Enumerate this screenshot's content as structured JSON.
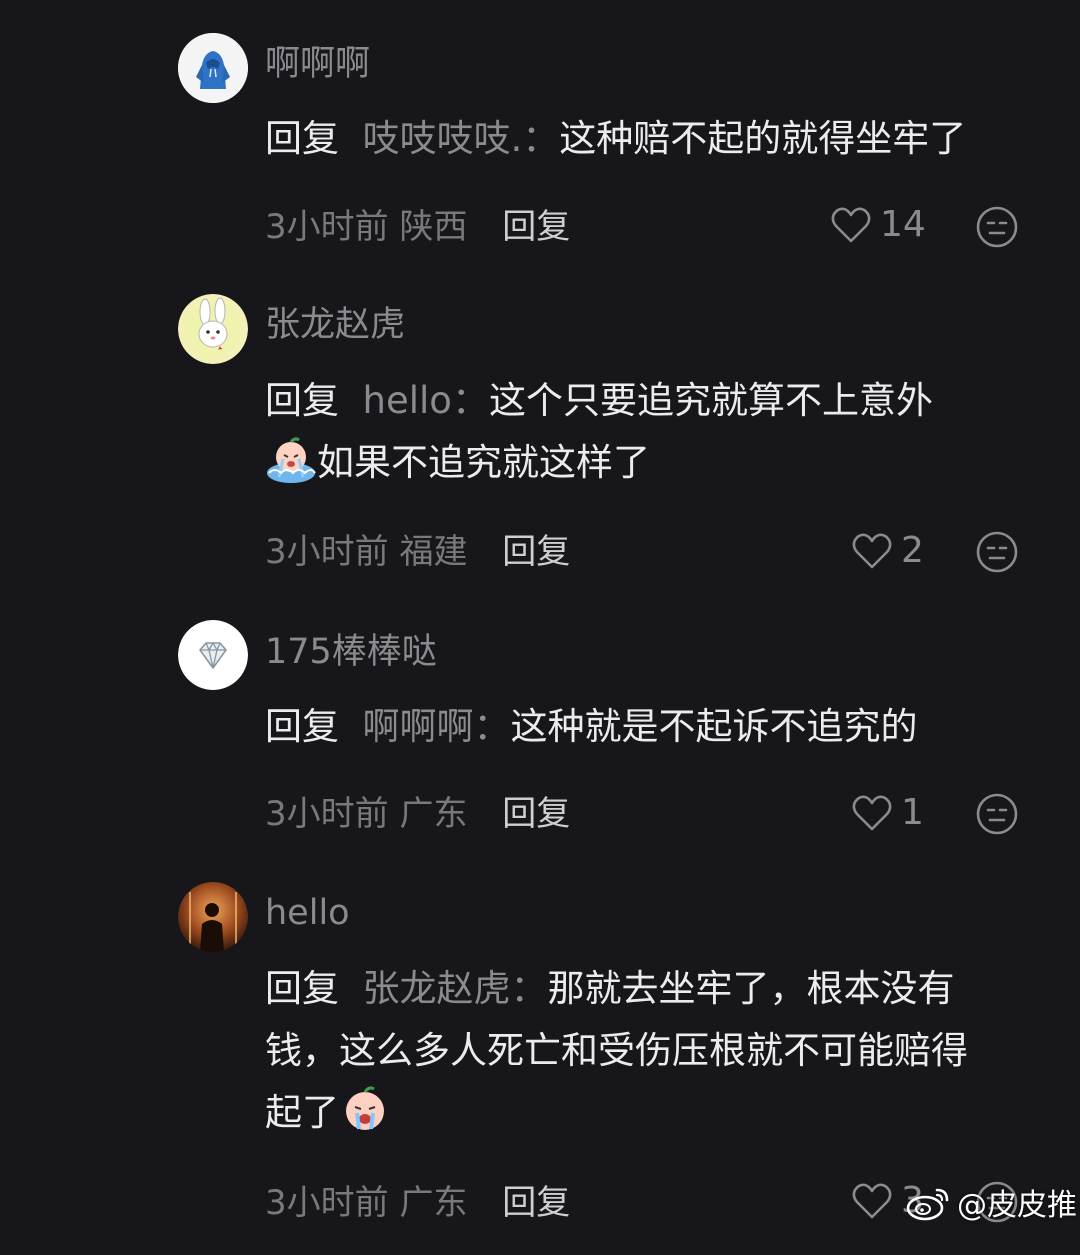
{
  "comments": [
    {
      "username": "啊啊啊",
      "reply_word": "回复",
      "reply_to": "吱吱吱吱.",
      "sep": "：",
      "text": "这种赔不起的就得坐牢了",
      "time": "3小时前",
      "location": "陕西",
      "reply_button": "回复",
      "likes": "14",
      "avatar_icon": "hoodie-icon"
    },
    {
      "username": "张龙赵虎",
      "reply_word": "回复",
      "reply_to": "hello",
      "sep": "：",
      "text": "这个只要追究就算不上意外",
      "text2": "如果不追究就这样了",
      "time": "3小时前",
      "location": "福建",
      "reply_button": "回复",
      "likes": "2",
      "avatar_icon": "rabbit-icon"
    },
    {
      "username": "175棒棒哒",
      "reply_word": "回复",
      "reply_to": "啊啊啊",
      "sep": "：",
      "text": "这种就是不起诉不追究的",
      "time": "3小时前",
      "location": "广东",
      "reply_button": "回复",
      "likes": "1",
      "avatar_icon": "diamond-icon"
    },
    {
      "username": "hello",
      "reply_word": "回复",
      "reply_to": "张龙赵虎",
      "sep": "：",
      "text": "那就去坐牢了，根本没有",
      "text2": "钱，这么多人死亡和受伤压根就不可能赔得",
      "text3": "起了",
      "time": "3小时前",
      "location": "广东",
      "reply_button": "回复",
      "likes": "3",
      "avatar_icon": "person-photo-icon"
    }
  ],
  "watermark": {
    "text": "@皮皮推",
    "icon": "weibo-icon"
  },
  "colors": {
    "background": "#17171b",
    "username": "#8a8a8f",
    "body_text": "#ececee",
    "meta": "#78787d"
  }
}
